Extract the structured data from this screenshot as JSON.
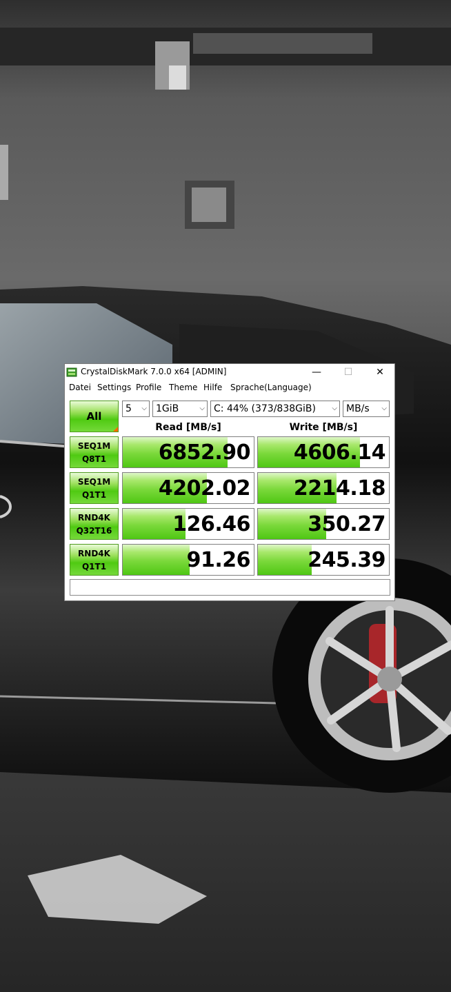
{
  "window": {
    "title": "CrystalDiskMark 7.0.0 x64 [ADMIN]",
    "controls": {
      "minimize": "—",
      "maximize": "☐",
      "close": "✕"
    }
  },
  "menu": [
    "Datei",
    "Settings",
    "Profile",
    "Theme",
    "Hilfe",
    "Sprache(Language)"
  ],
  "toolbar": {
    "all_label": "All",
    "count": "5",
    "size": "1GiB",
    "drive": "C: 44% (373/838GiB)",
    "unit": "MB/s"
  },
  "headers": {
    "read": "Read [MB/s]",
    "write": "Write [MB/s]"
  },
  "tests": [
    {
      "line1": "SEQ1M",
      "line2": "Q8T1",
      "read": "6852.90",
      "write": "4606.14",
      "read_fill": 0.8,
      "write_fill": 0.78
    },
    {
      "line1": "SEQ1M",
      "line2": "Q1T1",
      "read": "4202.02",
      "write": "2214.18",
      "read_fill": 0.64,
      "write_fill": 0.6
    },
    {
      "line1": "RND4K",
      "line2": "Q32T16",
      "read": "126.46",
      "write": "350.27",
      "read_fill": 0.48,
      "write_fill": 0.52
    },
    {
      "line1": "RND4K",
      "line2": "Q1T1",
      "read": "91.26",
      "write": "245.39",
      "read_fill": 0.51,
      "write_fill": 0.41
    }
  ],
  "comment": ""
}
